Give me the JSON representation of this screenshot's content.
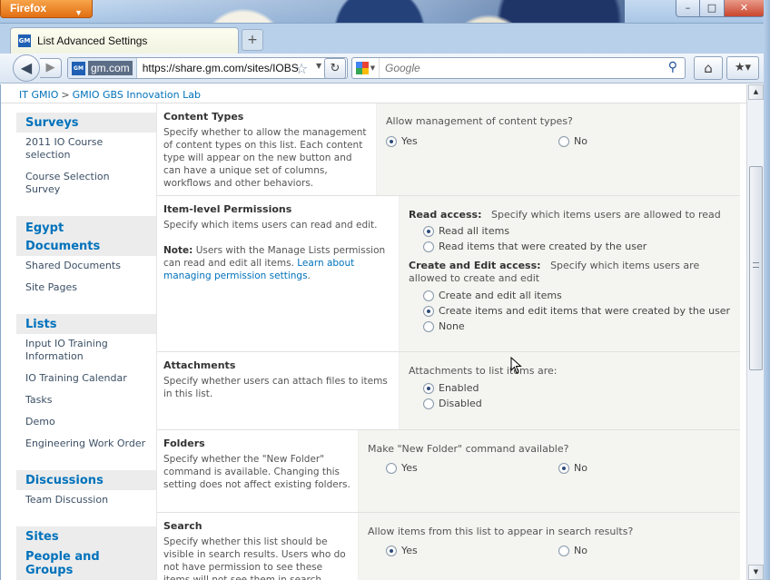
{
  "browser": {
    "app_button": "Firefox",
    "tab_title": "List Advanced Settings",
    "tab_favicon_text": "GM",
    "site_identity": "gm.com",
    "url": "https://share.gm.com/sites/IOBS",
    "search_placeholder": "Google",
    "search_engine_icon": "google-icon"
  },
  "breadcrumb": {
    "root": "IT GMIO",
    "separator": ">",
    "current": "GMIO GBS Innovation Lab"
  },
  "quicklaunch": {
    "surveys_heading": "Surveys",
    "surveys_items": [
      "2011 IO Course selection",
      "Course Selection Survey"
    ],
    "egypt_heading": "Egypt",
    "documents_heading": "Documents",
    "documents_items": [
      "Shared Documents",
      "Site Pages"
    ],
    "lists_heading": "Lists",
    "lists_items": [
      "Input IO Training Information",
      "IO Training Calendar",
      "Tasks",
      "Demo",
      "Engineering Work Order"
    ],
    "discussions_heading": "Discussions",
    "discussions_items": [
      "Team Discussion"
    ],
    "sites_heading": "Sites",
    "people_heading": "People and Groups"
  },
  "sections": {
    "content_types": {
      "title": "Content Types",
      "desc": "Specify whether to allow the management of content types on this list. Each content type will appear on the new button and can have a unique set of columns, workflows and other behaviors.",
      "question": "Allow management of content types?",
      "yes": "Yes",
      "no": "No",
      "selected": "Yes"
    },
    "item_permissions": {
      "title": "Item-level Permissions",
      "desc": "Specify which items users can read and edit.",
      "note_label": "Note:",
      "note_text": "Users with the Manage Lists permission can read and edit all items.",
      "note_link": "Learn about managing permission settings",
      "note_end": ".",
      "read_label": "Read access:",
      "read_desc": "Specify which items users are allowed to read",
      "read_all": "Read all items",
      "read_own": "Read items that were created by the user",
      "read_selected": "Read all items",
      "edit_label": "Create and Edit access:",
      "edit_desc": "Specify which items users are allowed to create and edit",
      "edit_all": "Create and edit all items",
      "edit_own": "Create items and edit items that were created by the user",
      "edit_none": "None",
      "edit_selected": "Create items and edit items that were created by the user"
    },
    "attachments": {
      "title": "Attachments",
      "desc": "Specify whether users can attach files to items in this list.",
      "question": "Attachments to list items are:",
      "enabled": "Enabled",
      "disabled": "Disabled",
      "selected": "Enabled"
    },
    "folders": {
      "title": "Folders",
      "desc": "Specify whether the \"New Folder\" command is available. Changing this setting does not affect existing folders.",
      "question": "Make \"New Folder\" command available?",
      "yes": "Yes",
      "no": "No",
      "selected": "No"
    },
    "search": {
      "title": "Search",
      "desc": "Specify whether this list should be visible in search results. Users who do not have permission to see these items will not see them in search results, no",
      "question": "Allow items from this list to appear in search results?",
      "yes": "Yes",
      "no": "No",
      "selected": "Yes"
    }
  },
  "colors": {
    "link": "#0072bc",
    "firefox_orange": "#e26f13",
    "chrome_blue": "#b9d0ea"
  }
}
